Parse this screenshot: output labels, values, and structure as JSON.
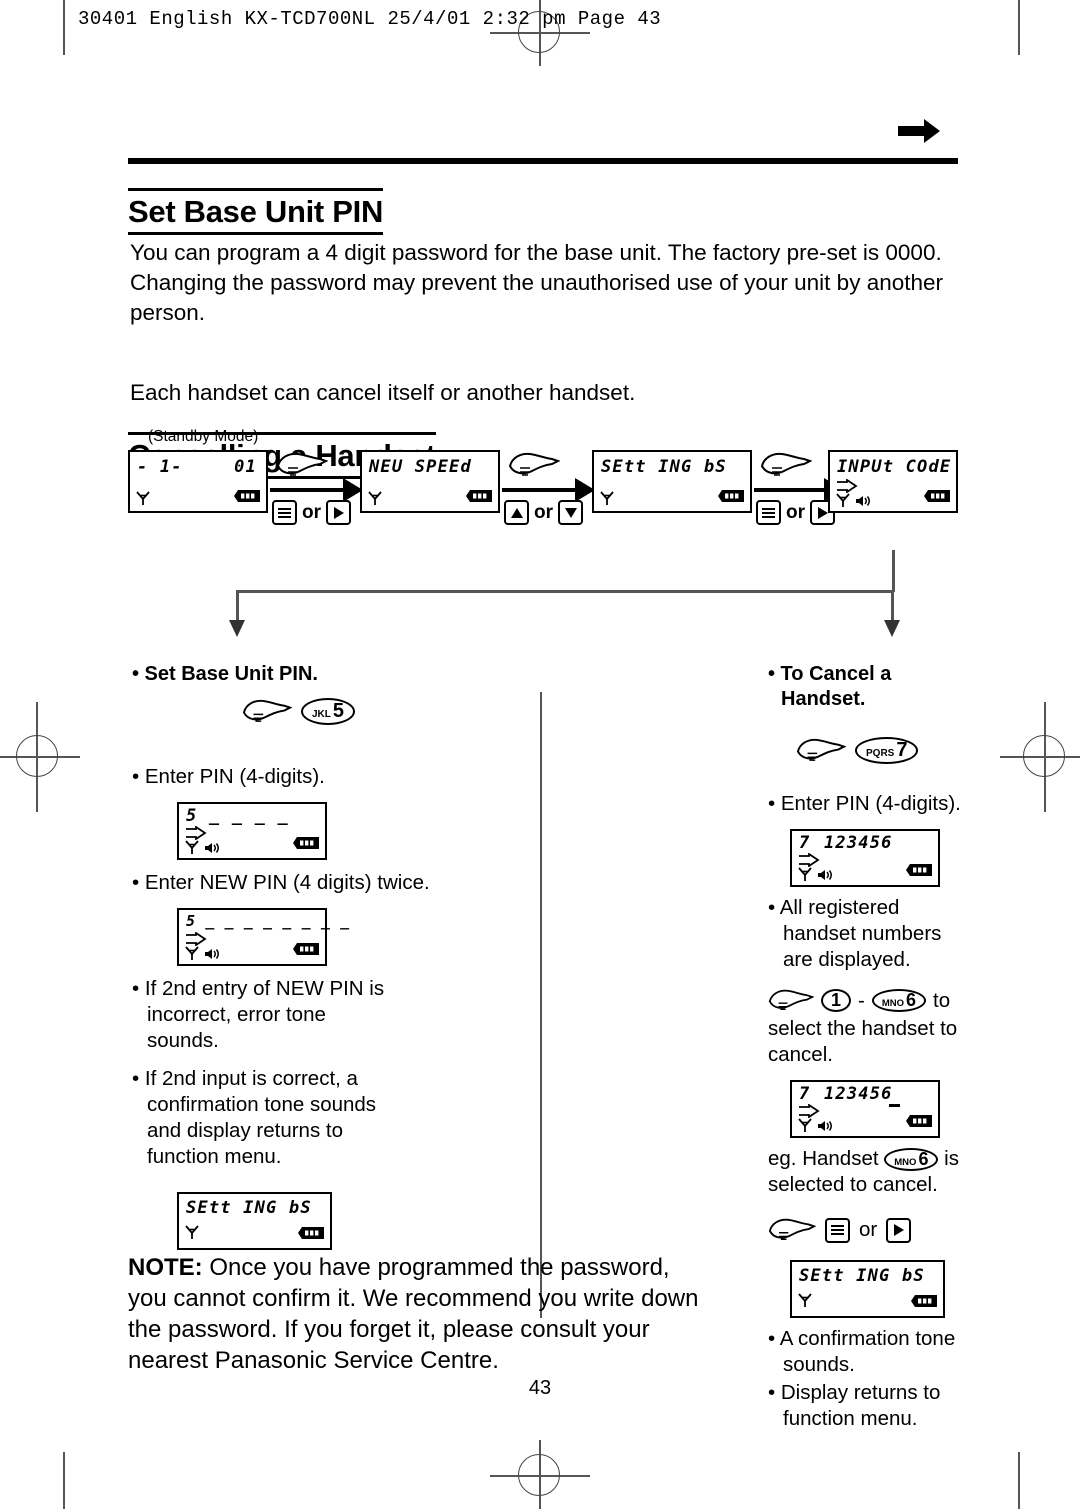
{
  "page_header": "30401 English KX-TCD700NL  25/4/01  2:32 pm  Page 43",
  "page_number": "43",
  "sections": {
    "pin": {
      "title": "Set Base Unit PIN",
      "body": "You can program a 4 digit password for the base unit. The factory pre-set is 0000. Changing the password may prevent the unauthorised use of your unit by another person."
    },
    "cancel": {
      "title": "Cancelling a Handset",
      "body": "Each handset can cancel itself or another handset."
    }
  },
  "flow": {
    "standby_label": "(Standby Mode)",
    "steps": [
      {
        "display_left": "- 1-",
        "display_right": "01",
        "keys": [
          "menu-icon",
          "right-icon"
        ],
        "or_label": "or"
      },
      {
        "display_left": "NEU SPEEd",
        "display_right": "",
        "keys": [
          "up-icon",
          "down-icon"
        ],
        "or_label": "or"
      },
      {
        "display_left": "SEtt ING bS",
        "display_right": "",
        "keys": [
          "menu-icon",
          "right-icon"
        ],
        "or_label": "or"
      },
      {
        "display_left": "INPUt COdE",
        "display_right": "",
        "keys": [],
        "or_label": ""
      }
    ]
  },
  "left_column": {
    "heading": "• Set Base Unit PIN.",
    "key": {
      "letters": "JKL",
      "digit": "5"
    },
    "step1": "• Enter PIN (4-digits).",
    "display1": "5  _ _ _ _",
    "step2": "• Enter NEW PIN (4 digits) twice.",
    "display2": "5  _ _ _ _  _ _ _ _",
    "note1": "• If 2nd entry of NEW PIN is incorrect, error tone sounds.",
    "note2": "• If 2nd input is correct, a confirmation tone sounds and display returns to function menu.",
    "display3": "SEtt ING bS"
  },
  "right_column": {
    "heading": "• To Cancel a Handset.",
    "key": {
      "letters": "PQRS",
      "digit": "7"
    },
    "step1": "• Enter PIN (4-digits).",
    "display1_prefix": "7",
    "display1_value": "123456",
    "note1": "• All registered handset numbers are displayed.",
    "select_range_from": "1",
    "select_range_to_letters": "MNO",
    "select_range_to_digit": "6",
    "select_suffix": "to",
    "select_text": "select the handset to cancel.",
    "display2_prefix": "7",
    "display2_value": "123456",
    "eg_prefix": "eg. Handset",
    "eg_letters": "MNO",
    "eg_digit": "6",
    "eg_suffix": "is selected to cancel.",
    "or_label": "or",
    "display3": "SEtt ING bS",
    "note2": "• A confirmation tone sounds.",
    "note3": "• Display returns to function menu."
  },
  "note": {
    "label": "NOTE:",
    "text": " Once you have programmed the password, you cannot confirm it. We recommend you write down the password. If you forget it, please consult your nearest Panasonic Service Centre."
  }
}
